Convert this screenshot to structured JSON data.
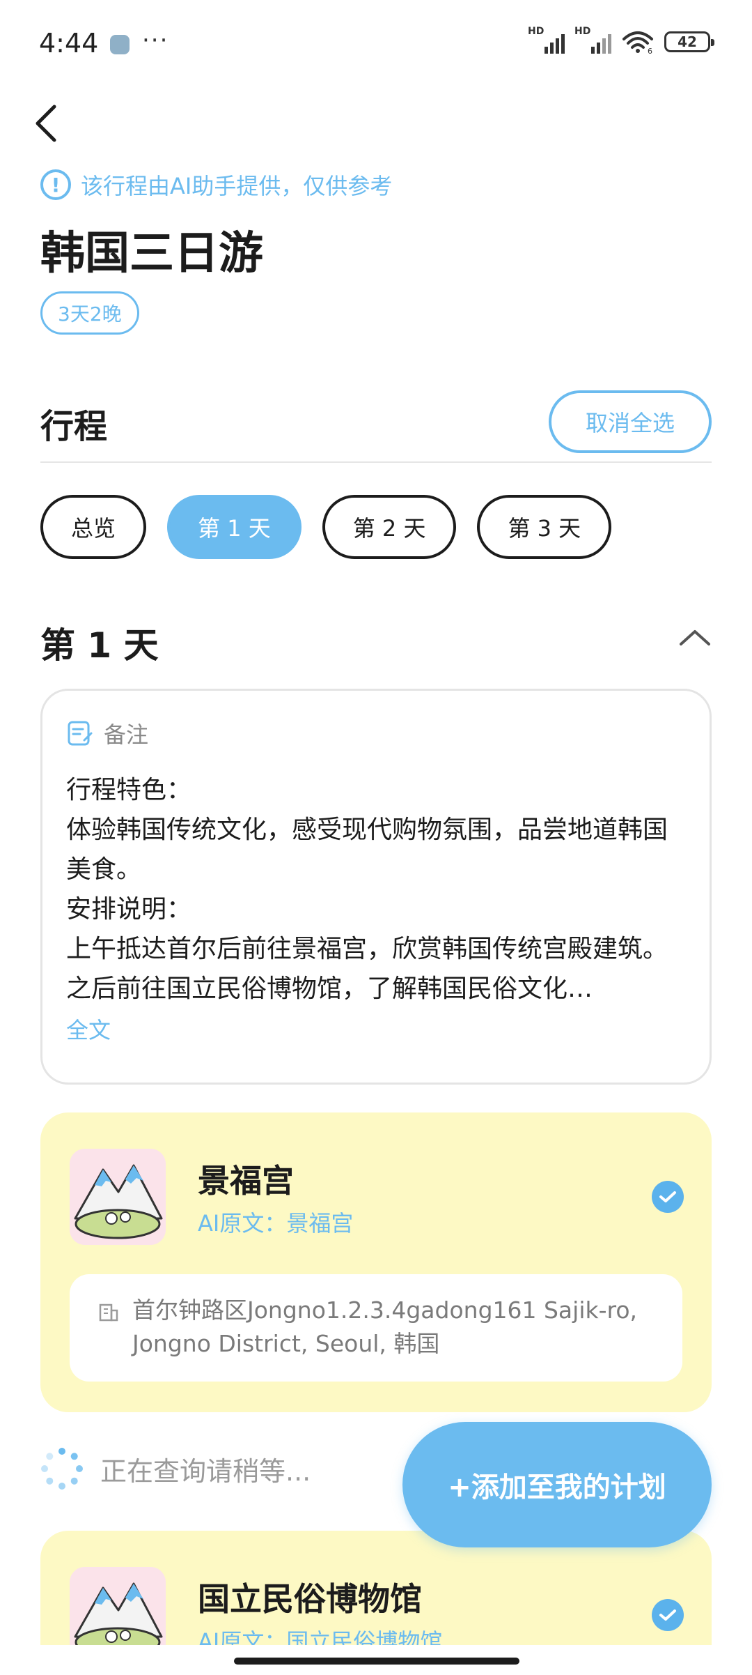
{
  "status_bar": {
    "time": "4:44",
    "more": "···",
    "signal_label_1": "HD",
    "signal_label_2": "HD",
    "wifi_sub": "6",
    "battery": "42"
  },
  "header": {
    "back_icon": "chevron-left-icon",
    "ai_notice": "该行程由AI助手提供，仅供参考",
    "title": "韩国三日游",
    "duration": "3天2晚"
  },
  "itinerary": {
    "section_title": "行程",
    "deselect_all": "取消全选",
    "tabs": [
      {
        "label": "总览",
        "active": false
      },
      {
        "label": "第 1 天",
        "active": true
      },
      {
        "label": "第 2 天",
        "active": false
      },
      {
        "label": "第 3 天",
        "active": false
      }
    ]
  },
  "day": {
    "title": "第 1 天",
    "notes_label": "备注",
    "notes_text": "行程特色：\n体验韩国传统文化，感受现代购物氛围，品尝地道韩国美食。\n安排说明：\n上午抵达首尔后前往景福宫，欣赏韩国传统宫殿建筑。之后前往国立民俗博物馆，了解韩国民俗文化…",
    "notes_more": "全文"
  },
  "pois": [
    {
      "name": "景福宫",
      "ai_original": "AI原文：景福宫",
      "address": "首尔钟路区Jongno1.2.3.4gadong161 Sajik-ro, Jongno District, Seoul, 韩国",
      "checked": true
    },
    {
      "name": "国立民俗博物馆",
      "ai_original": "AI原文：国立民俗博物馆",
      "checked": true
    }
  ],
  "loading_text": "正在查询请稍等...",
  "add_plan_button": "+添加至我的计划",
  "colors": {
    "accent": "#6bbbef",
    "card_yellow": "#fdf9c4",
    "text": "#1c1c1c"
  }
}
